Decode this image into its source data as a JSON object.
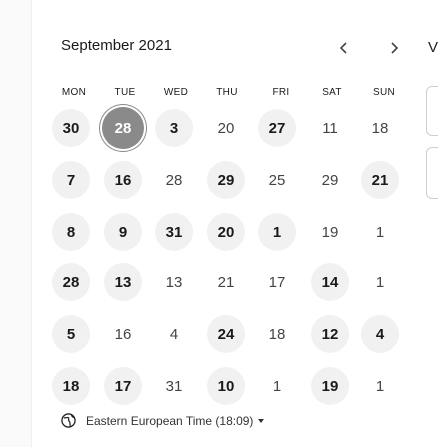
{
  "calendar": {
    "month_label": "September 2021",
    "nav": {
      "prev_icon": "chevron-left-icon",
      "next_icon": "chevron-right-icon"
    },
    "peek_letter": "V",
    "weekdays": [
      "MON",
      "TUE",
      "WED",
      "THU",
      "FRI",
      "SAT",
      "SUN"
    ],
    "rows": [
      [
        {
          "label": "30",
          "state": "available"
        },
        {
          "label": "28",
          "state": "selected"
        },
        {
          "label": "3",
          "state": "available"
        },
        {
          "label": "20",
          "state": "plain"
        },
        {
          "label": "27",
          "state": "available"
        },
        {
          "label": "11",
          "state": "plain"
        },
        {
          "label": "18",
          "state": "plain"
        }
      ],
      [
        {
          "label": "7",
          "state": "available"
        },
        {
          "label": "16",
          "state": "available"
        },
        {
          "label": "28",
          "state": "plain"
        },
        {
          "label": "29",
          "state": "available"
        },
        {
          "label": "25",
          "state": "plain"
        },
        {
          "label": "29",
          "state": "plain"
        },
        {
          "label": "21",
          "state": "available"
        }
      ],
      [
        {
          "label": "8",
          "state": "available"
        },
        {
          "label": "9",
          "state": "available"
        },
        {
          "label": "31",
          "state": "available"
        },
        {
          "label": "20",
          "state": "available"
        },
        {
          "label": "1",
          "state": "available"
        },
        {
          "label": "19",
          "state": "plain"
        },
        {
          "label": "1",
          "state": "plain"
        }
      ],
      [
        {
          "label": "28",
          "state": "available"
        },
        {
          "label": "13",
          "state": "available"
        },
        {
          "label": "13",
          "state": "plain"
        },
        {
          "label": "21",
          "state": "plain"
        },
        {
          "label": "17",
          "state": "plain"
        },
        {
          "label": "14",
          "state": "available"
        },
        {
          "label": "1",
          "state": "plain"
        }
      ],
      [
        {
          "label": "5",
          "state": "available"
        },
        {
          "label": "16",
          "state": "plain"
        },
        {
          "label": "4",
          "state": "plain"
        },
        {
          "label": "24",
          "state": "available"
        },
        {
          "label": "18",
          "state": "plain"
        },
        {
          "label": "12",
          "state": "available"
        },
        {
          "label": "4",
          "state": "available"
        }
      ],
      [
        {
          "label": "18",
          "state": "available"
        },
        {
          "label": "17",
          "state": "available"
        },
        {
          "label": "31",
          "state": "plain"
        },
        {
          "label": "10",
          "state": "available"
        },
        {
          "label": "1",
          "state": "plain"
        },
        {
          "label": "19",
          "state": "available"
        },
        {
          "label": "1",
          "state": "plain"
        }
      ]
    ]
  },
  "timezone": {
    "label": "Eastern European Time (18:09)",
    "icon": "globe-icon",
    "caret_icon": "caret-down-icon"
  },
  "colors": {
    "selected": "#8a8a8a",
    "available_bg": "#f1f1f1"
  }
}
